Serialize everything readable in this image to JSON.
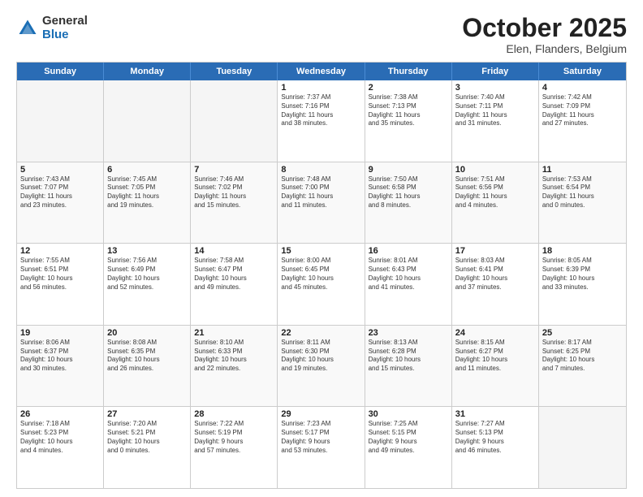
{
  "logo": {
    "general": "General",
    "blue": "Blue"
  },
  "title": "October 2025",
  "subtitle": "Elen, Flanders, Belgium",
  "headers": [
    "Sunday",
    "Monday",
    "Tuesday",
    "Wednesday",
    "Thursday",
    "Friday",
    "Saturday"
  ],
  "weeks": [
    [
      {
        "day": "",
        "info": ""
      },
      {
        "day": "",
        "info": ""
      },
      {
        "day": "",
        "info": ""
      },
      {
        "day": "1",
        "info": "Sunrise: 7:37 AM\nSunset: 7:16 PM\nDaylight: 11 hours\nand 38 minutes."
      },
      {
        "day": "2",
        "info": "Sunrise: 7:38 AM\nSunset: 7:13 PM\nDaylight: 11 hours\nand 35 minutes."
      },
      {
        "day": "3",
        "info": "Sunrise: 7:40 AM\nSunset: 7:11 PM\nDaylight: 11 hours\nand 31 minutes."
      },
      {
        "day": "4",
        "info": "Sunrise: 7:42 AM\nSunset: 7:09 PM\nDaylight: 11 hours\nand 27 minutes."
      }
    ],
    [
      {
        "day": "5",
        "info": "Sunrise: 7:43 AM\nSunset: 7:07 PM\nDaylight: 11 hours\nand 23 minutes."
      },
      {
        "day": "6",
        "info": "Sunrise: 7:45 AM\nSunset: 7:05 PM\nDaylight: 11 hours\nand 19 minutes."
      },
      {
        "day": "7",
        "info": "Sunrise: 7:46 AM\nSunset: 7:02 PM\nDaylight: 11 hours\nand 15 minutes."
      },
      {
        "day": "8",
        "info": "Sunrise: 7:48 AM\nSunset: 7:00 PM\nDaylight: 11 hours\nand 11 minutes."
      },
      {
        "day": "9",
        "info": "Sunrise: 7:50 AM\nSunset: 6:58 PM\nDaylight: 11 hours\nand 8 minutes."
      },
      {
        "day": "10",
        "info": "Sunrise: 7:51 AM\nSunset: 6:56 PM\nDaylight: 11 hours\nand 4 minutes."
      },
      {
        "day": "11",
        "info": "Sunrise: 7:53 AM\nSunset: 6:54 PM\nDaylight: 11 hours\nand 0 minutes."
      }
    ],
    [
      {
        "day": "12",
        "info": "Sunrise: 7:55 AM\nSunset: 6:51 PM\nDaylight: 10 hours\nand 56 minutes."
      },
      {
        "day": "13",
        "info": "Sunrise: 7:56 AM\nSunset: 6:49 PM\nDaylight: 10 hours\nand 52 minutes."
      },
      {
        "day": "14",
        "info": "Sunrise: 7:58 AM\nSunset: 6:47 PM\nDaylight: 10 hours\nand 49 minutes."
      },
      {
        "day": "15",
        "info": "Sunrise: 8:00 AM\nSunset: 6:45 PM\nDaylight: 10 hours\nand 45 minutes."
      },
      {
        "day": "16",
        "info": "Sunrise: 8:01 AM\nSunset: 6:43 PM\nDaylight: 10 hours\nand 41 minutes."
      },
      {
        "day": "17",
        "info": "Sunrise: 8:03 AM\nSunset: 6:41 PM\nDaylight: 10 hours\nand 37 minutes."
      },
      {
        "day": "18",
        "info": "Sunrise: 8:05 AM\nSunset: 6:39 PM\nDaylight: 10 hours\nand 33 minutes."
      }
    ],
    [
      {
        "day": "19",
        "info": "Sunrise: 8:06 AM\nSunset: 6:37 PM\nDaylight: 10 hours\nand 30 minutes."
      },
      {
        "day": "20",
        "info": "Sunrise: 8:08 AM\nSunset: 6:35 PM\nDaylight: 10 hours\nand 26 minutes."
      },
      {
        "day": "21",
        "info": "Sunrise: 8:10 AM\nSunset: 6:33 PM\nDaylight: 10 hours\nand 22 minutes."
      },
      {
        "day": "22",
        "info": "Sunrise: 8:11 AM\nSunset: 6:30 PM\nDaylight: 10 hours\nand 19 minutes."
      },
      {
        "day": "23",
        "info": "Sunrise: 8:13 AM\nSunset: 6:28 PM\nDaylight: 10 hours\nand 15 minutes."
      },
      {
        "day": "24",
        "info": "Sunrise: 8:15 AM\nSunset: 6:27 PM\nDaylight: 10 hours\nand 11 minutes."
      },
      {
        "day": "25",
        "info": "Sunrise: 8:17 AM\nSunset: 6:25 PM\nDaylight: 10 hours\nand 7 minutes."
      }
    ],
    [
      {
        "day": "26",
        "info": "Sunrise: 7:18 AM\nSunset: 5:23 PM\nDaylight: 10 hours\nand 4 minutes."
      },
      {
        "day": "27",
        "info": "Sunrise: 7:20 AM\nSunset: 5:21 PM\nDaylight: 10 hours\nand 0 minutes."
      },
      {
        "day": "28",
        "info": "Sunrise: 7:22 AM\nSunset: 5:19 PM\nDaylight: 9 hours\nand 57 minutes."
      },
      {
        "day": "29",
        "info": "Sunrise: 7:23 AM\nSunset: 5:17 PM\nDaylight: 9 hours\nand 53 minutes."
      },
      {
        "day": "30",
        "info": "Sunrise: 7:25 AM\nSunset: 5:15 PM\nDaylight: 9 hours\nand 49 minutes."
      },
      {
        "day": "31",
        "info": "Sunrise: 7:27 AM\nSunset: 5:13 PM\nDaylight: 9 hours\nand 46 minutes."
      },
      {
        "day": "",
        "info": ""
      }
    ]
  ]
}
